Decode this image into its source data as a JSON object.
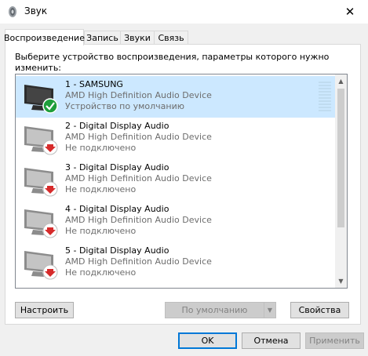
{
  "window": {
    "title": "Звук",
    "close_glyph": "✕",
    "icon": "speaker-icon"
  },
  "tabs": [
    {
      "label": "Воспроизведение",
      "active": true
    },
    {
      "label": "Запись",
      "active": false
    },
    {
      "label": "Звуки",
      "active": false
    },
    {
      "label": "Связь",
      "active": false
    }
  ],
  "instruction": "Выберите устройство воспроизведения, параметры которого нужно изменить:",
  "devices": [
    {
      "name": "1 - SAMSUNG",
      "description": "AMD High Definition Audio Device",
      "status": "Устройство по умолчанию",
      "selected": true,
      "badge": "check-icon"
    },
    {
      "name": "2 - Digital Display Audio",
      "description": "AMD High Definition Audio Device",
      "status": "Не подключено",
      "selected": false,
      "badge": "down-arrow-icon"
    },
    {
      "name": "3 - Digital Display Audio",
      "description": "AMD High Definition Audio Device",
      "status": "Не подключено",
      "selected": false,
      "badge": "down-arrow-icon"
    },
    {
      "name": "4 - Digital Display Audio",
      "description": "AMD High Definition Audio Device",
      "status": "Не подключено",
      "selected": false,
      "badge": "down-arrow-icon"
    },
    {
      "name": "5 - Digital Display Audio",
      "description": "AMD High Definition Audio Device",
      "status": "Не подключено",
      "selected": false,
      "badge": "down-arrow-icon"
    }
  ],
  "buttons": {
    "configure": "Настроить",
    "set_default": "По умолчанию",
    "properties": "Свойства",
    "ok": "OK",
    "cancel": "Отмена",
    "apply": "Применить"
  },
  "colors": {
    "selection": "#cce8ff",
    "accent": "#0078d7",
    "check_badge": "#1e9e3a",
    "arrow_badge": "#d62b2b"
  }
}
